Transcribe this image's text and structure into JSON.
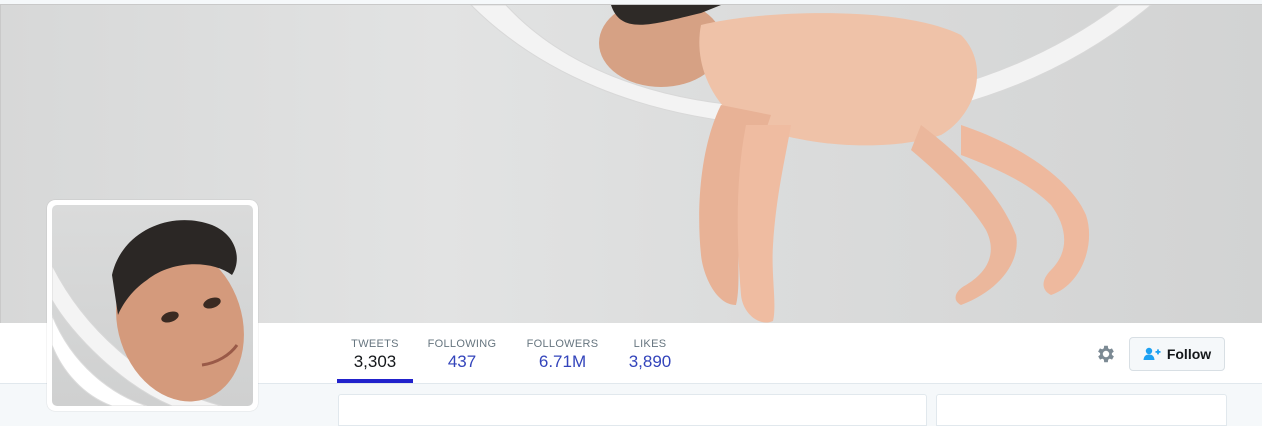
{
  "profile": {
    "stats": [
      {
        "label": "TWEETS",
        "value": "3,303"
      },
      {
        "label": "FOLLOWING",
        "value": "437"
      },
      {
        "label": "FOLLOWERS",
        "value": "6.71M"
      },
      {
        "label": "LIKES",
        "value": "3,890"
      }
    ],
    "follow_label": "Follow",
    "active_tab": "TWEETS"
  },
  "colors": {
    "accent": "#2222cc",
    "stat_value": "#3344bb",
    "muted": "#66757f"
  },
  "icons": {
    "settings": "gear-icon",
    "follow": "add-user-icon"
  }
}
